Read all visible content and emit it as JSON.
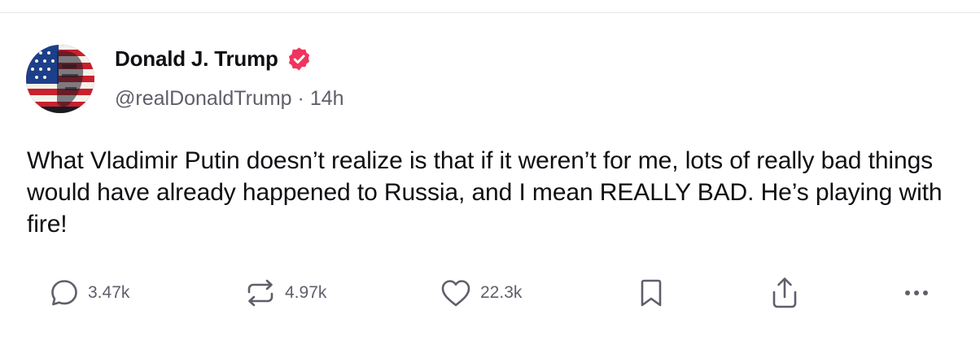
{
  "post": {
    "author": {
      "display_name": "Donald J. Trump",
      "verified": true,
      "handle": "@realDonaldTrump",
      "separator": " · ",
      "time_ago": "14h"
    },
    "text": "What Vladimir Putin doesn’t realize is that if it weren’t for me, lots of really bad things would have already happened to Russia, and I mean REALLY BAD. He’s playing with fire!",
    "actions": {
      "reply_count": "3.47k",
      "repost_count": "4.97k",
      "like_count": "22.3k"
    }
  },
  "icons": {
    "reply": "speech-bubble-icon",
    "repost": "repost-arrows-icon",
    "like": "heart-icon",
    "bookmark": "bookmark-icon",
    "share": "share-upload-icon",
    "more": "ellipsis-icon",
    "verified": "verified-badge-icon"
  },
  "colors": {
    "verified_badge": "#f0345d",
    "text_primary": "#0f0f14",
    "text_secondary": "#5f5f6b",
    "icon": "#5f5f6b"
  }
}
